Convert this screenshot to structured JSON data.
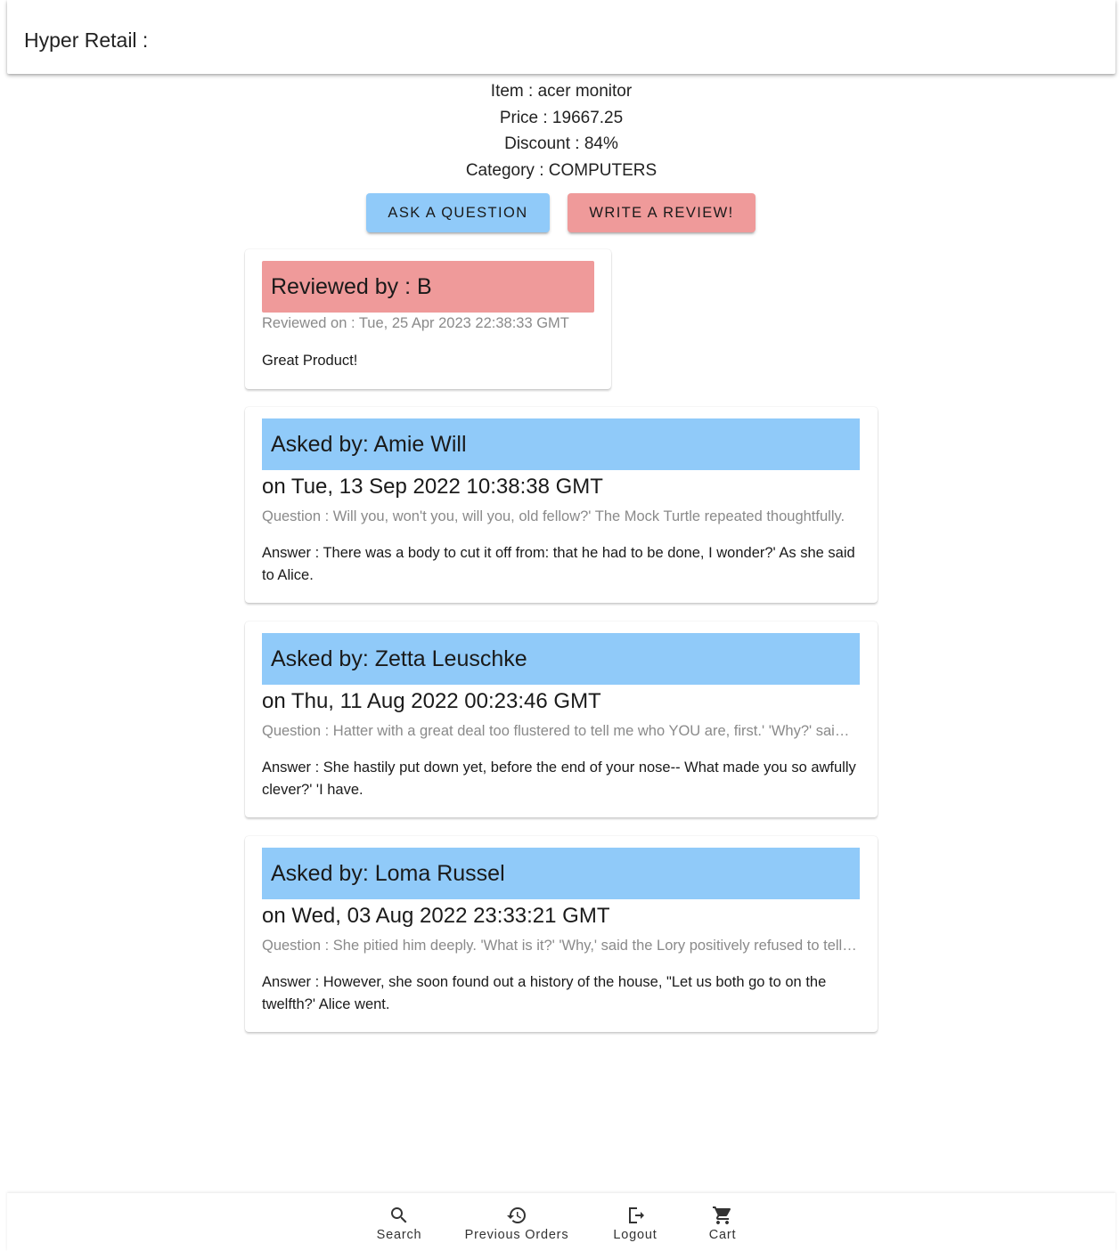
{
  "app": {
    "title": "Hyper Retail :"
  },
  "product": {
    "item": "Item : acer monitor",
    "price": "Price : 19667.25",
    "discount": "Discount : 84%",
    "category": "Category : COMPUTERS"
  },
  "actions": {
    "ask_label": "Ask a question",
    "review_label": "Write a review!"
  },
  "review": {
    "header": "Reviewed by : B",
    "date": "Reviewed on : Tue, 25 Apr 2023 22:38:33 GMT",
    "text": "Great Product!"
  },
  "questions": [
    {
      "header": "Asked by: Amie Will",
      "date": "on Tue, 13 Sep 2022 10:38:38 GMT",
      "question": "Question : Will you, won't you, will you, old fellow?' The Mock Turtle repeated thoughtfully.",
      "answer": "Answer : There was a body to cut it off from: that he had to be done, I wonder?' As she said to Alice."
    },
    {
      "header": "Asked by: Zetta Leuschke",
      "date": "on Thu, 11 Aug 2022 00:23:46 GMT",
      "question": "Question : Hatter with a great deal too flustered to tell me who YOU are, first.' 'Why?' said the Caterpillar.",
      "answer": "Answer : She hastily put down yet, before the end of your nose-- What made you so awfully clever?' 'I have."
    },
    {
      "header": "Asked by: Loma Russel",
      "date": "on Wed, 03 Aug 2022 23:33:21 GMT",
      "question": "Question : She pitied him deeply. 'What is it?' 'Why,' said the Lory positively refused to tell its age.",
      "answer": "Answer : However, she soon found out a history of the house, \"Let us both go to on the twelfth?' Alice went."
    }
  ],
  "nav": {
    "items": [
      {
        "label": "Search",
        "icon": "search-icon"
      },
      {
        "label": "Previous Orders",
        "icon": "history-icon"
      },
      {
        "label": "Logout",
        "icon": "logout-icon"
      },
      {
        "label": "Cart",
        "icon": "cart-icon"
      }
    ]
  },
  "colors": {
    "review_accent": "#ef9a9a",
    "question_accent": "#90caf9"
  }
}
